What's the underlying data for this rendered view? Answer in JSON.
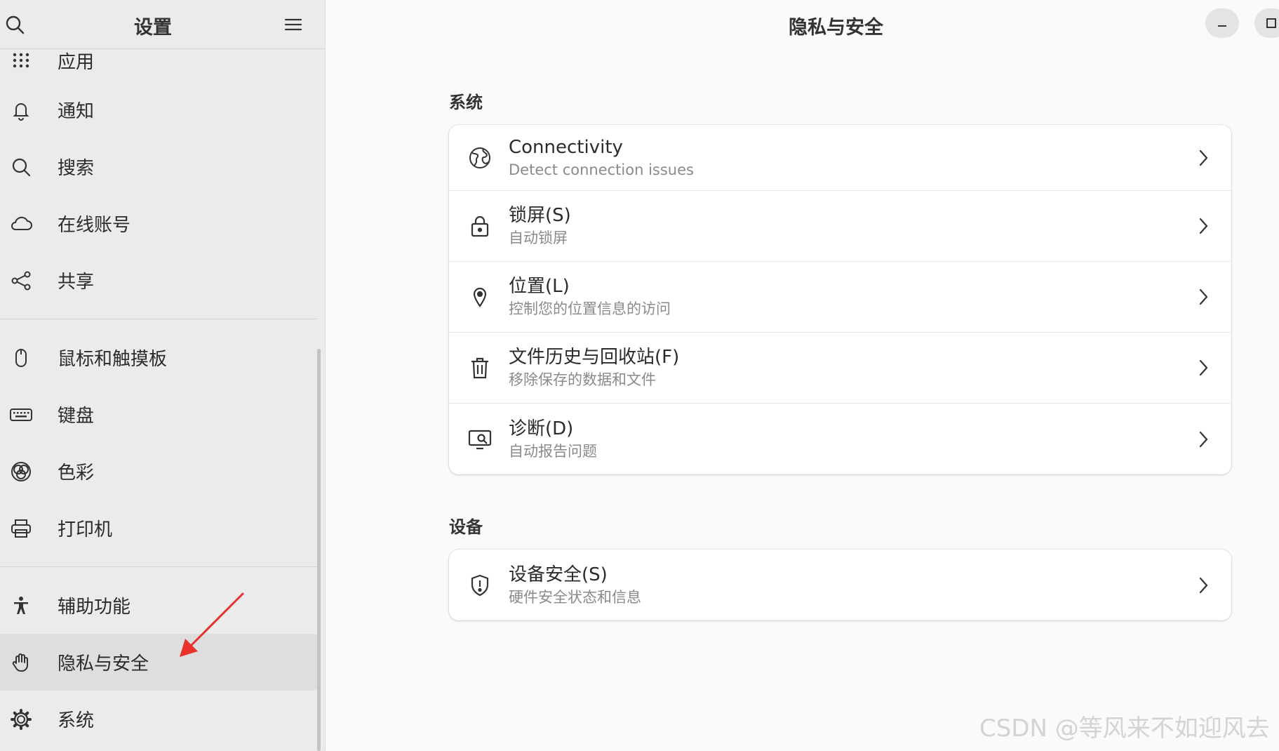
{
  "sidebar": {
    "title": "设置",
    "groups": [
      [
        {
          "label": "应用",
          "icon": "apps-grid-icon"
        },
        {
          "label": "通知",
          "icon": "bell-icon"
        },
        {
          "label": "搜索",
          "icon": "search-icon"
        },
        {
          "label": "在线账号",
          "icon": "cloud-icon"
        },
        {
          "label": "共享",
          "icon": "share-icon"
        }
      ],
      [
        {
          "label": "鼠标和触摸板",
          "icon": "mouse-icon"
        },
        {
          "label": "键盘",
          "icon": "keyboard-icon"
        },
        {
          "label": "色彩",
          "icon": "color-icon"
        },
        {
          "label": "打印机",
          "icon": "printer-icon"
        }
      ],
      [
        {
          "label": "辅助功能",
          "icon": "accessibility-icon"
        },
        {
          "label": "隐私与安全",
          "icon": "hand-icon",
          "active": true
        },
        {
          "label": "系统",
          "icon": "gear-icon"
        }
      ]
    ]
  },
  "main": {
    "title": "隐私与安全",
    "sections": [
      {
        "title": "系统",
        "rows": [
          {
            "title": "Connectivity",
            "subtitle": "Detect connection issues",
            "icon": "globe-icon"
          },
          {
            "title": "锁屏(S)",
            "subtitle": "自动锁屏",
            "icon": "lock-icon"
          },
          {
            "title": "位置(L)",
            "subtitle": "控制您的位置信息的访问",
            "icon": "location-pin-icon"
          },
          {
            "title": "文件历史与回收站(F)",
            "subtitle": "移除保存的数据和文件",
            "icon": "trash-icon"
          },
          {
            "title": "诊断(D)",
            "subtitle": "自动报告问题",
            "icon": "diagnostics-icon"
          }
        ]
      },
      {
        "title": "设备",
        "rows": [
          {
            "title": "设备安全(S)",
            "subtitle": "硬件安全状态和信息",
            "icon": "shield-icon"
          }
        ]
      }
    ]
  },
  "watermark": "CSDN @等风来不如迎风去",
  "colors": {
    "sidebar_bg": "#ebebeb",
    "active_bg": "#dedede",
    "main_bg": "#fafafa",
    "arrow": "#e8322c"
  }
}
